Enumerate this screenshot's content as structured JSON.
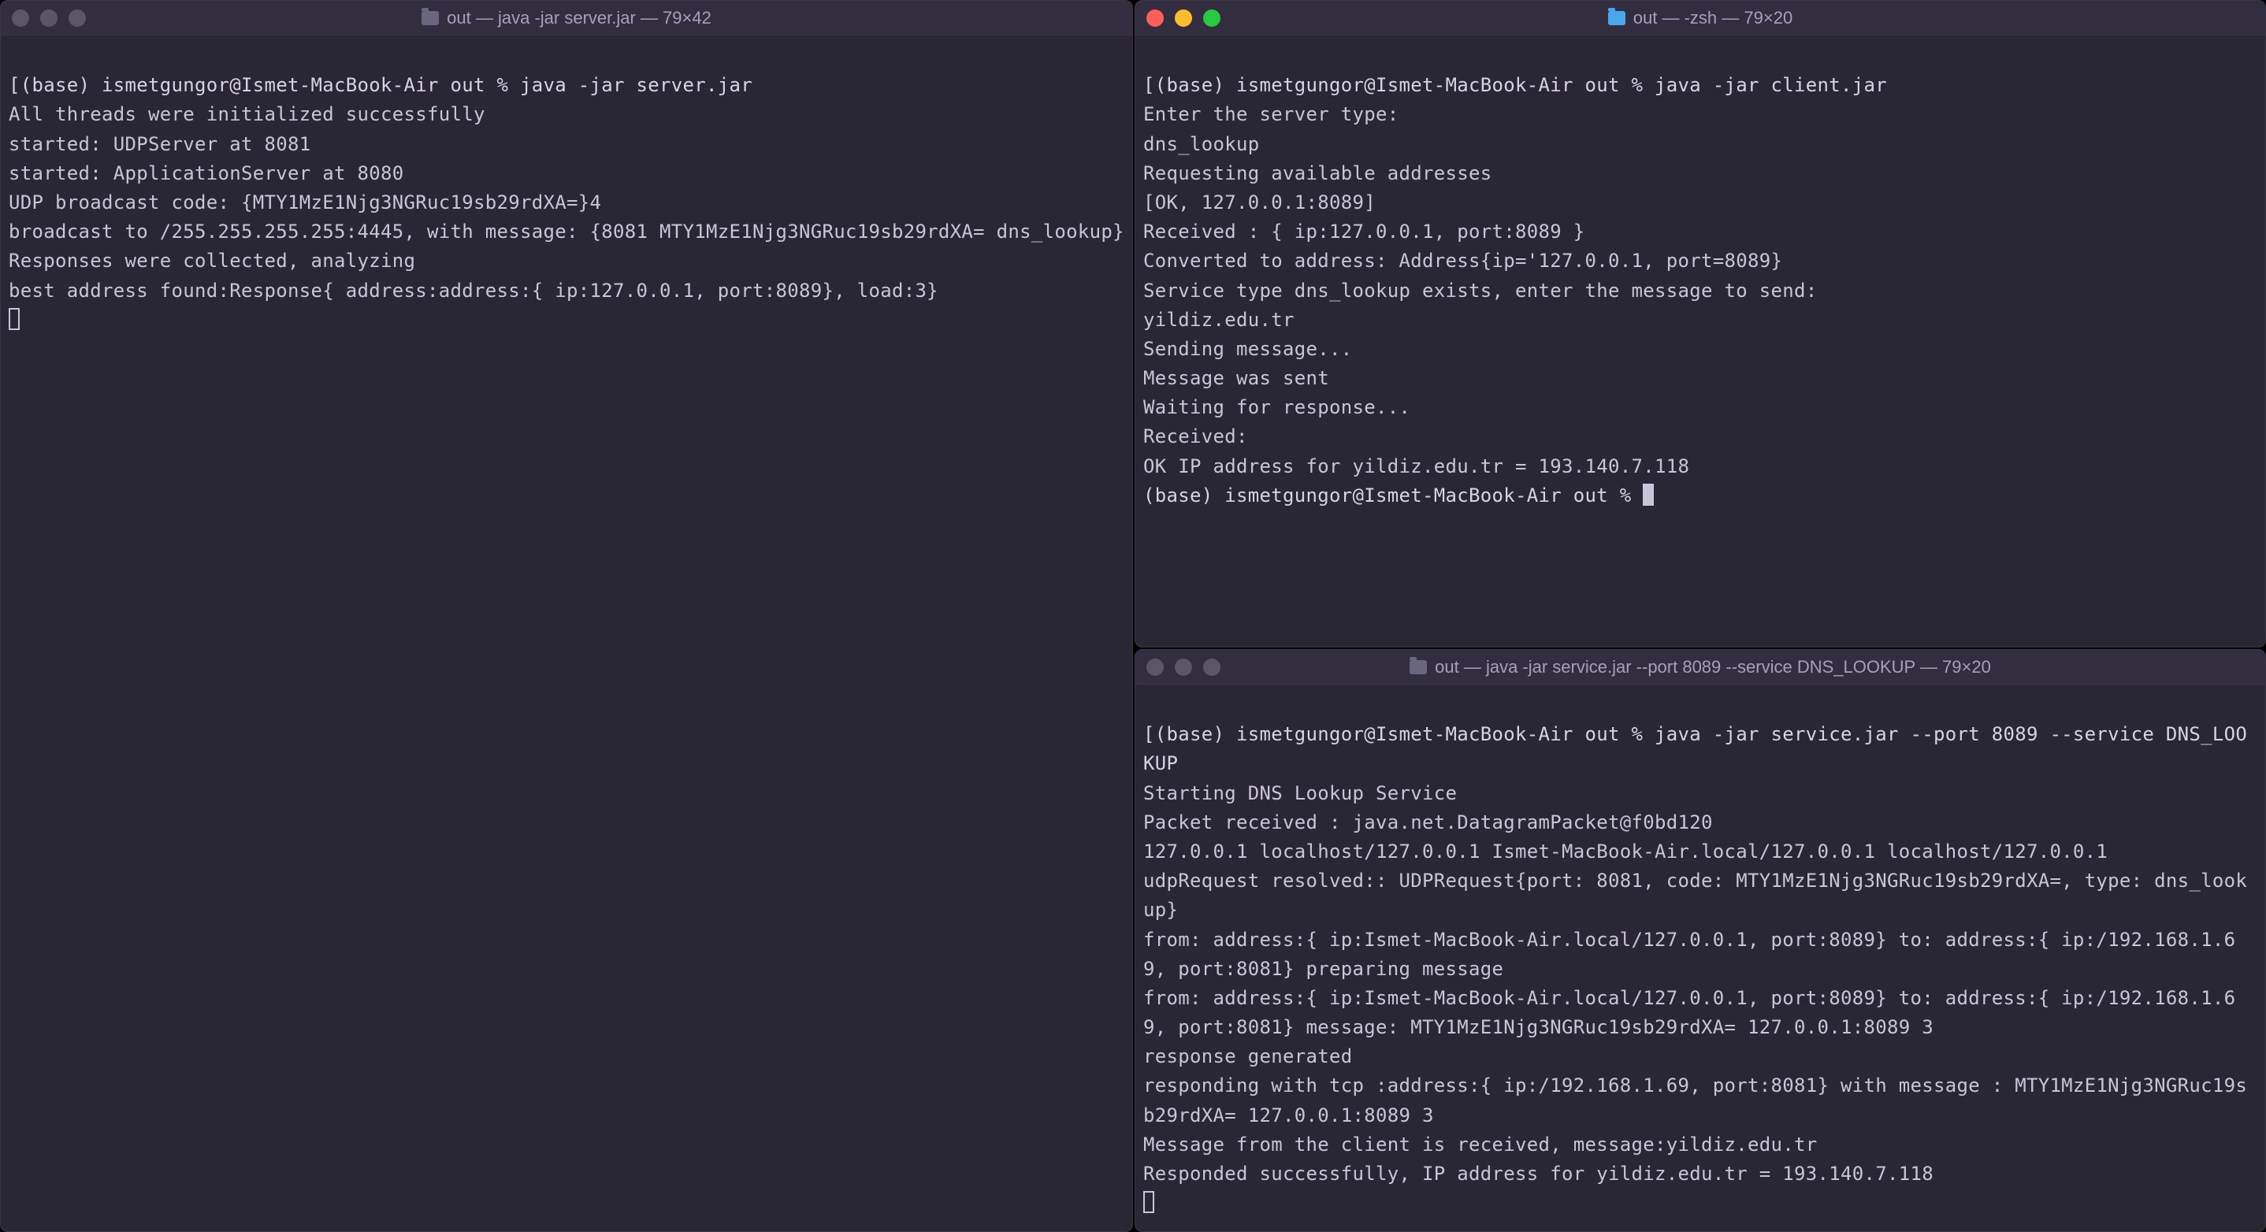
{
  "windows": {
    "left": {
      "active": false,
      "title": "out — java -jar server.jar — 79×42",
      "lines": [
        "[(base) ismetgungor@Ismet-MacBook-Air out % java -jar server.jar",
        "All threads were initialized successfully",
        "started: UDPServer at 8081",
        "started: ApplicationServer at 8080",
        "UDP broadcast code: {MTY1MzE1Njg3NGRuc19sb29rdXA=}4",
        "broadcast to /255.255.255.255:4445, with message: {8081 MTY1MzE1Njg3NGRuc19sb29rdXA= dns_lookup}",
        "Responses were collected, analyzing",
        "best address found:Response{ address:address:{ ip:127.0.0.1, port:8089}, load:3}"
      ]
    },
    "topRight": {
      "active": true,
      "title": "out — -zsh — 79×20",
      "lines": [
        "[(base) ismetgungor@Ismet-MacBook-Air out % java -jar client.jar",
        "Enter the server type:",
        "dns_lookup",
        "Requesting available addresses",
        "[OK, 127.0.0.1:8089]",
        "Received : { ip:127.0.0.1, port:8089 }",
        "Converted to address: Address{ip='127.0.0.1, port=8089}",
        "Service type dns_lookup exists, enter the message to send:",
        "yildiz.edu.tr",
        "Sending message...",
        "Message was sent",
        "Waiting for response...",
        "Received:",
        "OK IP address for yildiz.edu.tr = 193.140.7.118",
        "(base) ismetgungor@Ismet-MacBook-Air out % "
      ]
    },
    "bottomRight": {
      "active": false,
      "title": "out — java -jar service.jar --port 8089 --service DNS_LOOKUP — 79×20",
      "lines": [
        "[(base) ismetgungor@Ismet-MacBook-Air out % java -jar service.jar --port 8089 --service DNS_LOOKUP",
        "Starting DNS Lookup Service",
        "Packet received : java.net.DatagramPacket@f0bd120",
        "127.0.0.1 localhost/127.0.0.1 Ismet-MacBook-Air.local/127.0.0.1 localhost/127.0.0.1",
        "udpRequest resolved:: UDPRequest{port: 8081, code: MTY1MzE1Njg3NGRuc19sb29rdXA=, type: dns_lookup}",
        "from: address:{ ip:Ismet-MacBook-Air.local/127.0.0.1, port:8089} to: address:{ ip:/192.168.1.69, port:8081} preparing message",
        "from: address:{ ip:Ismet-MacBook-Air.local/127.0.0.1, port:8089} to: address:{ ip:/192.168.1.69, port:8081} message: MTY1MzE1Njg3NGRuc19sb29rdXA= 127.0.0.1:8089 3",
        "response generated",
        "responding with tcp :address:{ ip:/192.168.1.69, port:8081} with message : MTY1MzE1Njg3NGRuc19sb29rdXA= 127.0.0.1:8089 3",
        "Message from the client is received, message:yildiz.edu.tr",
        "Responded successfully, IP address for yildiz.edu.tr = 193.140.7.118"
      ]
    }
  }
}
